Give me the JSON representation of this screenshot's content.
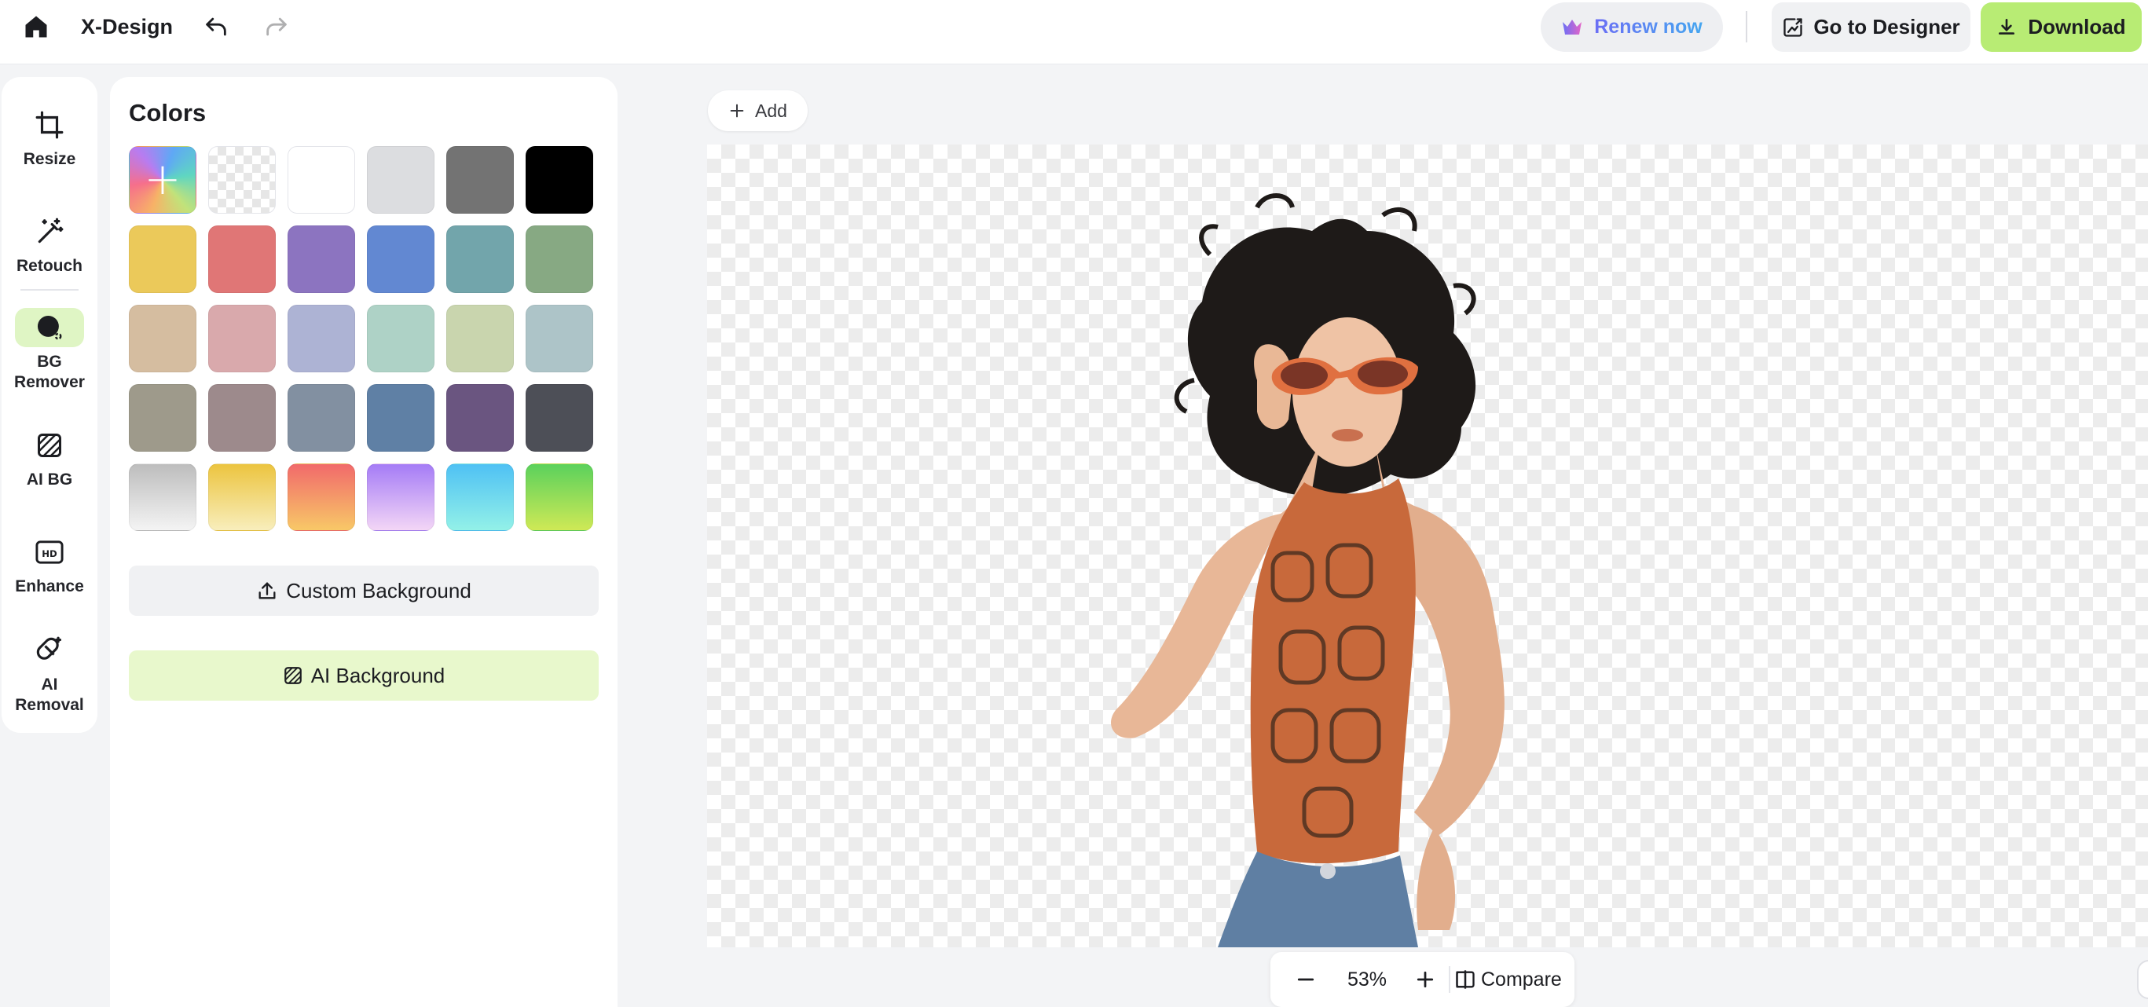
{
  "app": {
    "title": "X-Design"
  },
  "header": {
    "renew_label": "Renew now",
    "designer_label": "Go to Designer",
    "download_label": "Download"
  },
  "tools": [
    {
      "label": "Resize",
      "icon": "crop-icon"
    },
    {
      "label": "Retouch",
      "icon": "magic-wand-icon"
    },
    {
      "label": "BG\nRemover",
      "icon": "bg-remover-icon",
      "active": true
    },
    {
      "label": "AI BG",
      "icon": "ai-bg-icon"
    },
    {
      "label": "Enhance",
      "icon": "hd-icon"
    },
    {
      "label": "AI\nRemoval",
      "icon": "eraser-icon"
    }
  ],
  "panel": {
    "title": "Colors",
    "custom_bg_label": "Custom Background",
    "ai_bg_label": "AI Background",
    "swatches": [
      {
        "kind": "add",
        "color": "rainbow"
      },
      {
        "kind": "transparent",
        "color": "transparent"
      },
      {
        "kind": "solid",
        "color": "#ffffff"
      },
      {
        "kind": "solid",
        "color": "#dcdde0"
      },
      {
        "kind": "solid",
        "color": "#737373"
      },
      {
        "kind": "solid",
        "color": "#000000"
      },
      {
        "kind": "solid",
        "color": "#ebc95a"
      },
      {
        "kind": "solid",
        "color": "#e07676"
      },
      {
        "kind": "solid",
        "color": "#8c74c0"
      },
      {
        "kind": "solid",
        "color": "#6288d2"
      },
      {
        "kind": "solid",
        "color": "#72a5ab"
      },
      {
        "kind": "solid",
        "color": "#87a983"
      },
      {
        "kind": "solid",
        "color": "#d5bda0"
      },
      {
        "kind": "solid",
        "color": "#d9a9ac"
      },
      {
        "kind": "solid",
        "color": "#adb3d4"
      },
      {
        "kind": "solid",
        "color": "#aed2c6"
      },
      {
        "kind": "solid",
        "color": "#c9d5ae"
      },
      {
        "kind": "solid",
        "color": "#adc4c8"
      },
      {
        "kind": "solid",
        "color": "#9e9a8b"
      },
      {
        "kind": "solid",
        "color": "#9d8a8c"
      },
      {
        "kind": "solid",
        "color": "#8290a1"
      },
      {
        "kind": "solid",
        "color": "#5f80a5"
      },
      {
        "kind": "solid",
        "color": "#6a5580"
      },
      {
        "kind": "solid",
        "color": "#4d4f57"
      },
      {
        "kind": "gradient",
        "from": "#bdbdbd",
        "to": "#f4f4f4"
      },
      {
        "kind": "gradient",
        "from": "#ecc43f",
        "to": "#f8eebc"
      },
      {
        "kind": "gradient",
        "from": "#f16a6b",
        "to": "#f8c867"
      },
      {
        "kind": "gradient",
        "from": "#a57cf6",
        "to": "#f3d6f6"
      },
      {
        "kind": "gradient",
        "from": "#4fc1f4",
        "to": "#93f1e8"
      },
      {
        "kind": "gradient",
        "from": "#5bd15c",
        "to": "#cfe956"
      }
    ]
  },
  "canvas": {
    "add_label": "Add"
  },
  "zoom": {
    "value": "53%",
    "compare_label": "Compare"
  },
  "colors": {
    "accent_green": "#b8ec74",
    "active_tool_bg": "#dff5c4",
    "ai_bg_button": "#e8f8cc"
  }
}
